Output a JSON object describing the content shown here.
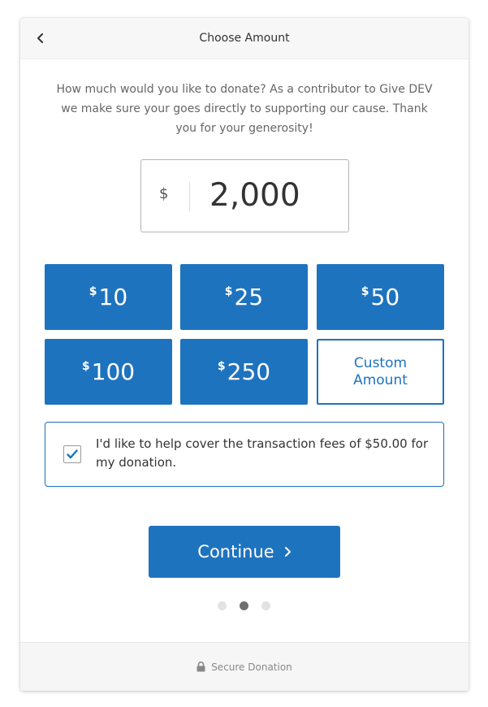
{
  "header": {
    "title": "Choose Amount",
    "back_icon": "chevron-left-icon"
  },
  "intro": "How much would you like to donate? As a contributor to Give DEV we make sure your goes directly to supporting our cause. Thank you for your generosity!",
  "amount": {
    "currency_symbol": "$",
    "value": "2,000"
  },
  "presets": [
    {
      "symbol": "$",
      "value": "10"
    },
    {
      "symbol": "$",
      "value": "25"
    },
    {
      "symbol": "$",
      "value": "50"
    },
    {
      "symbol": "$",
      "value": "100"
    },
    {
      "symbol": "$",
      "value": "250"
    }
  ],
  "custom_amount_label": "Custom Amount",
  "fees": {
    "checked": true,
    "label": "I'd like to help cover the transaction fees of $50.00 for my donation."
  },
  "continue_label": "Continue",
  "steps": {
    "total": 3,
    "current": 2
  },
  "footer": {
    "label": "Secure Donation",
    "icon": "lock-icon"
  },
  "colors": {
    "primary": "#1e73be",
    "footer_bg": "#f6f6f6"
  }
}
